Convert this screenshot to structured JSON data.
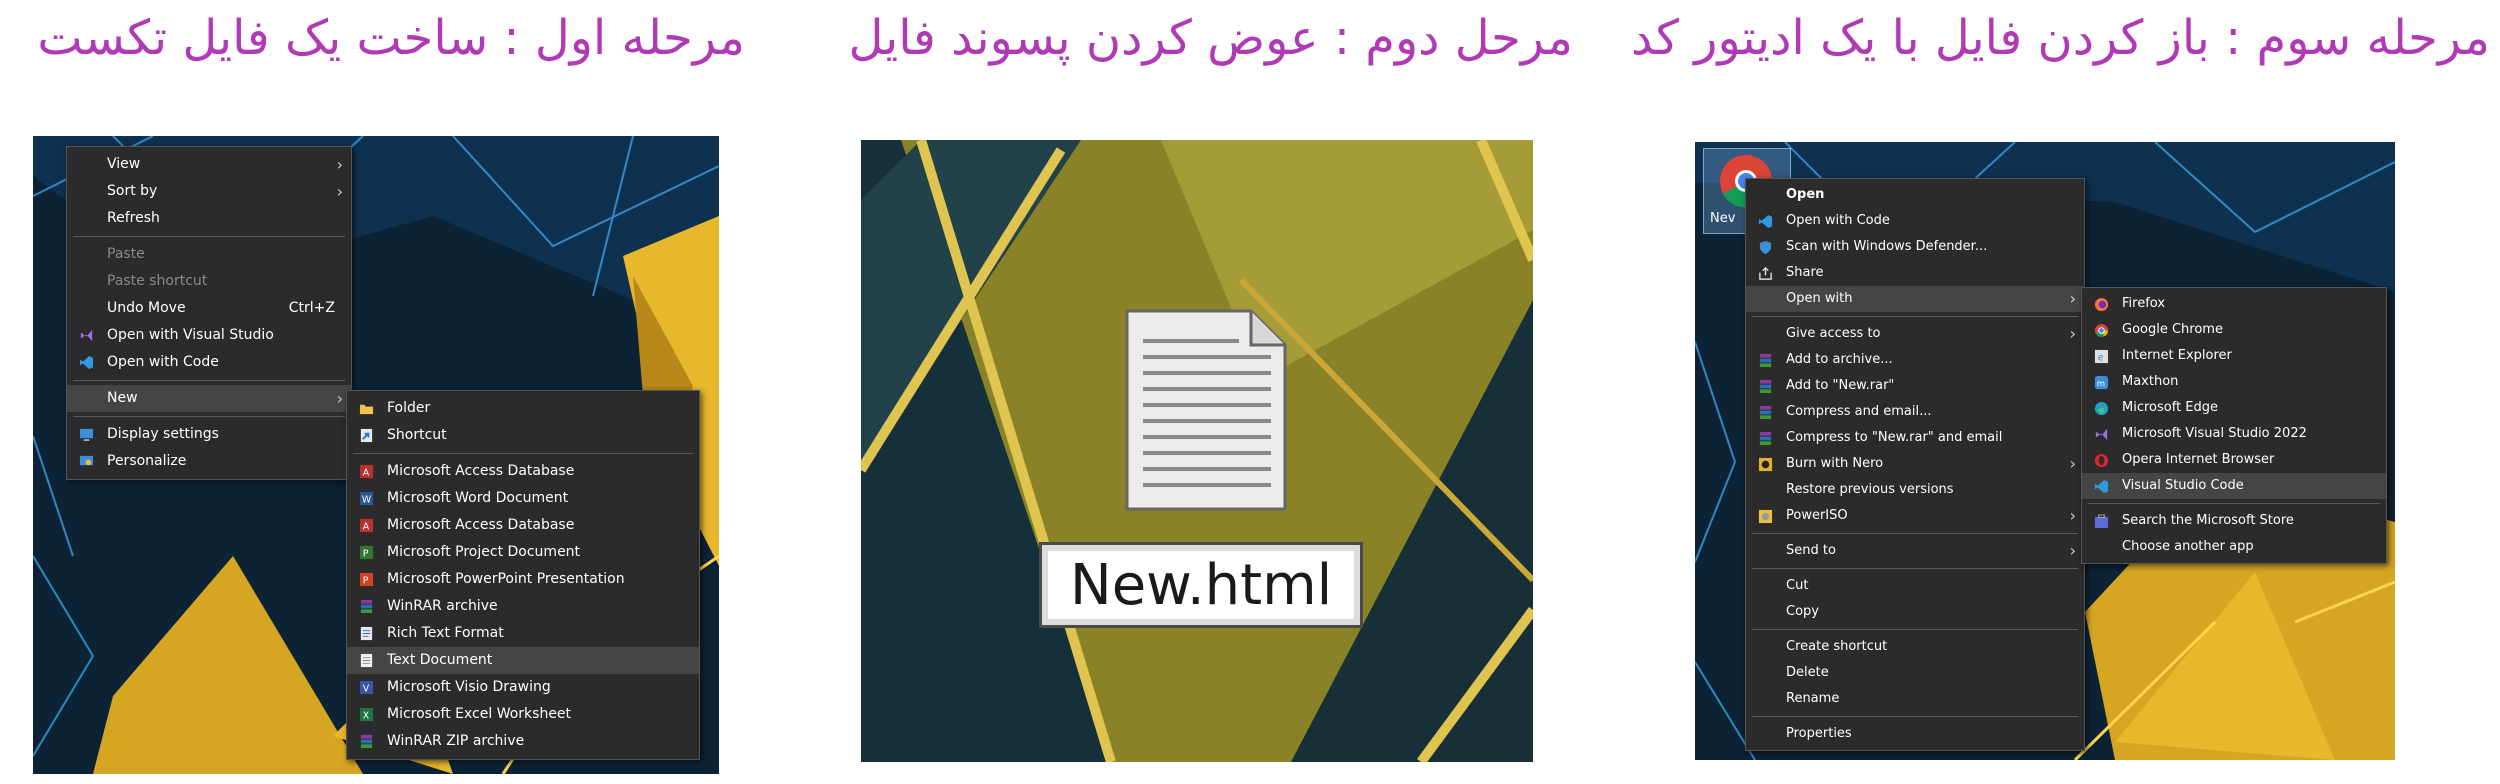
{
  "titles": {
    "step1": "مرحله اول  : ساخت یک فایل تکست",
    "step2": "مرحل دوم : عوض کردن پسوند فایل",
    "step3": "مرحله سوم : باز کردن فایل با یک ادیتور کد"
  },
  "colors": {
    "title": "#b03ab5",
    "menu_bg": "#2b2b2b",
    "highlight": "#454545"
  },
  "panel1": {
    "context_menu": [
      {
        "label": "View",
        "submenu": true
      },
      {
        "label": "Sort by",
        "submenu": true
      },
      {
        "label": "Refresh"
      },
      {
        "label": "Paste",
        "disabled": true
      },
      {
        "label": "Paste shortcut",
        "disabled": true
      },
      {
        "label": "Undo Move",
        "shortcut": "Ctrl+Z"
      },
      {
        "label": "Open with Visual Studio",
        "icon": "visual-studio-icon"
      },
      {
        "label": "Open with Code",
        "icon": "vscode-icon"
      },
      {
        "label": "New",
        "submenu": true,
        "highlighted": true
      },
      {
        "label": "Display settings",
        "icon": "display-icon"
      },
      {
        "label": "Personalize",
        "icon": "personalize-icon"
      }
    ],
    "new_submenu": [
      {
        "label": "Folder",
        "icon": "folder-icon"
      },
      {
        "label": "Shortcut",
        "icon": "shortcut-icon"
      },
      {
        "label": "Microsoft Access Database",
        "icon": "access-icon"
      },
      {
        "label": "Microsoft Word Document",
        "icon": "word-icon"
      },
      {
        "label": "Microsoft Access Database",
        "icon": "access-icon"
      },
      {
        "label": "Microsoft Project Document",
        "icon": "project-icon"
      },
      {
        "label": "Microsoft PowerPoint Presentation",
        "icon": "powerpoint-icon"
      },
      {
        "label": "WinRAR archive",
        "icon": "winrar-icon"
      },
      {
        "label": "Rich Text Format",
        "icon": "rtf-icon"
      },
      {
        "label": "Text Document",
        "icon": "text-document-icon",
        "highlighted": true
      },
      {
        "label": "Microsoft Visio Drawing",
        "icon": "visio-icon"
      },
      {
        "label": "Microsoft Excel Worksheet",
        "icon": "excel-icon"
      },
      {
        "label": "WinRAR ZIP archive",
        "icon": "winrar-zip-icon"
      }
    ]
  },
  "panel2": {
    "file_name": "New.html",
    "icon": "text-file-icon"
  },
  "panel3": {
    "desktop_icon_label": "Nev",
    "context_menu": [
      {
        "label": "Open",
        "bold": true
      },
      {
        "label": "Open with Code",
        "icon": "vscode-icon"
      },
      {
        "label": "Scan with Windows Defender...",
        "icon": "defender-icon"
      },
      {
        "label": "Share",
        "icon": "share-icon"
      },
      {
        "label": "Open with",
        "submenu": true,
        "highlighted": true
      },
      {
        "label": "Give access to",
        "submenu": true
      },
      {
        "label": "Add to archive...",
        "icon": "winrar-icon"
      },
      {
        "label": "Add to \"New.rar\"",
        "icon": "winrar-icon"
      },
      {
        "label": "Compress and email...",
        "icon": "winrar-icon"
      },
      {
        "label": "Compress to \"New.rar\" and email",
        "icon": "winrar-icon"
      },
      {
        "label": "Burn with Nero",
        "icon": "nero-icon",
        "submenu": true
      },
      {
        "label": "Restore previous versions"
      },
      {
        "label": "PowerISO",
        "icon": "poweriso-icon",
        "submenu": true
      },
      {
        "label": "Send to",
        "submenu": true
      },
      {
        "label": "Cut"
      },
      {
        "label": "Copy"
      },
      {
        "label": "Create shortcut"
      },
      {
        "label": "Delete"
      },
      {
        "label": "Rename"
      },
      {
        "label": "Properties"
      }
    ],
    "open_with_submenu": [
      {
        "label": "Firefox",
        "icon": "firefox-icon"
      },
      {
        "label": "Google Chrome",
        "icon": "chrome-icon"
      },
      {
        "label": "Internet Explorer",
        "icon": "ie-icon"
      },
      {
        "label": "Maxthon",
        "icon": "maxthon-icon"
      },
      {
        "label": "Microsoft Edge",
        "icon": "edge-icon"
      },
      {
        "label": "Microsoft Visual Studio 2022",
        "icon": "visual-studio-icon"
      },
      {
        "label": "Opera Internet Browser",
        "icon": "opera-icon"
      },
      {
        "label": "Visual Studio Code",
        "icon": "vscode-icon",
        "highlighted": true
      },
      {
        "label": "Search the Microsoft Store",
        "icon": "store-icon"
      },
      {
        "label": "Choose another app"
      }
    ]
  }
}
